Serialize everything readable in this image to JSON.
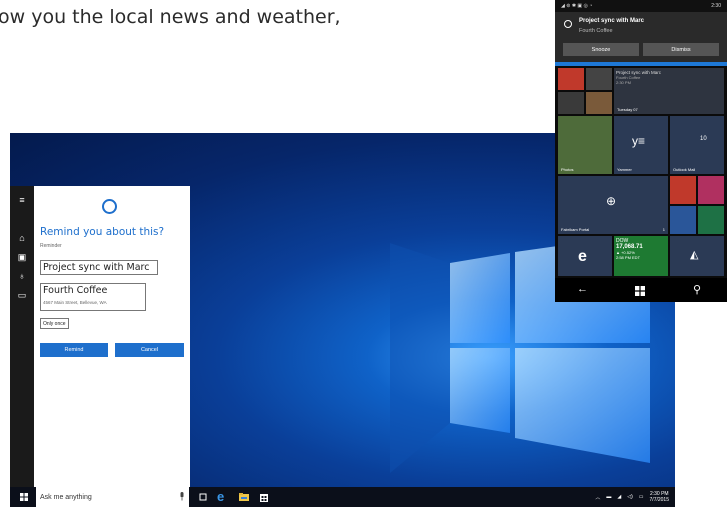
{
  "headline": "ow you the local news and weather,",
  "desktop": {
    "taskbar": {
      "search_placeholder": "Ask me anything",
      "clock_time": "2:30 PM",
      "clock_date": "7/7/2015"
    }
  },
  "cortana": {
    "title": "Remind you about this?",
    "reminder_label": "Reminder",
    "reminder_value": "Project sync with Marc",
    "place_name": "Fourth Coffee",
    "place_address": "4567 Main Street, Bellevue, WA",
    "repeat_value": "Only once",
    "remind_label": "Remind",
    "cancel_label": "Cancel",
    "accent": "#1e6fcc"
  },
  "phone": {
    "status_time": "2:30",
    "notification": {
      "title": "Project sync with Marc",
      "subtitle": "Fourth Coffee",
      "snooze_label": "Snooze",
      "dismiss_label": "Dismiss"
    },
    "tiles": {
      "calendar_event": "Project sync with Marc",
      "calendar_place": "Fourth Coffee",
      "calendar_time": "2:30 PM",
      "calendar_day": "Tuesday 07",
      "photos_label": "Photos",
      "yammer_label": "Yammer",
      "outlook_label": "Outlook Mail",
      "outlook_count": "10",
      "fabrikam_label": "Fabrikam Portal",
      "fabrikam_count": "1",
      "dow_label": "DOW",
      "dow_value": "17,068.71",
      "dow_change": "▲ +0.52%",
      "dow_time": "2:58 PM EDT"
    }
  }
}
